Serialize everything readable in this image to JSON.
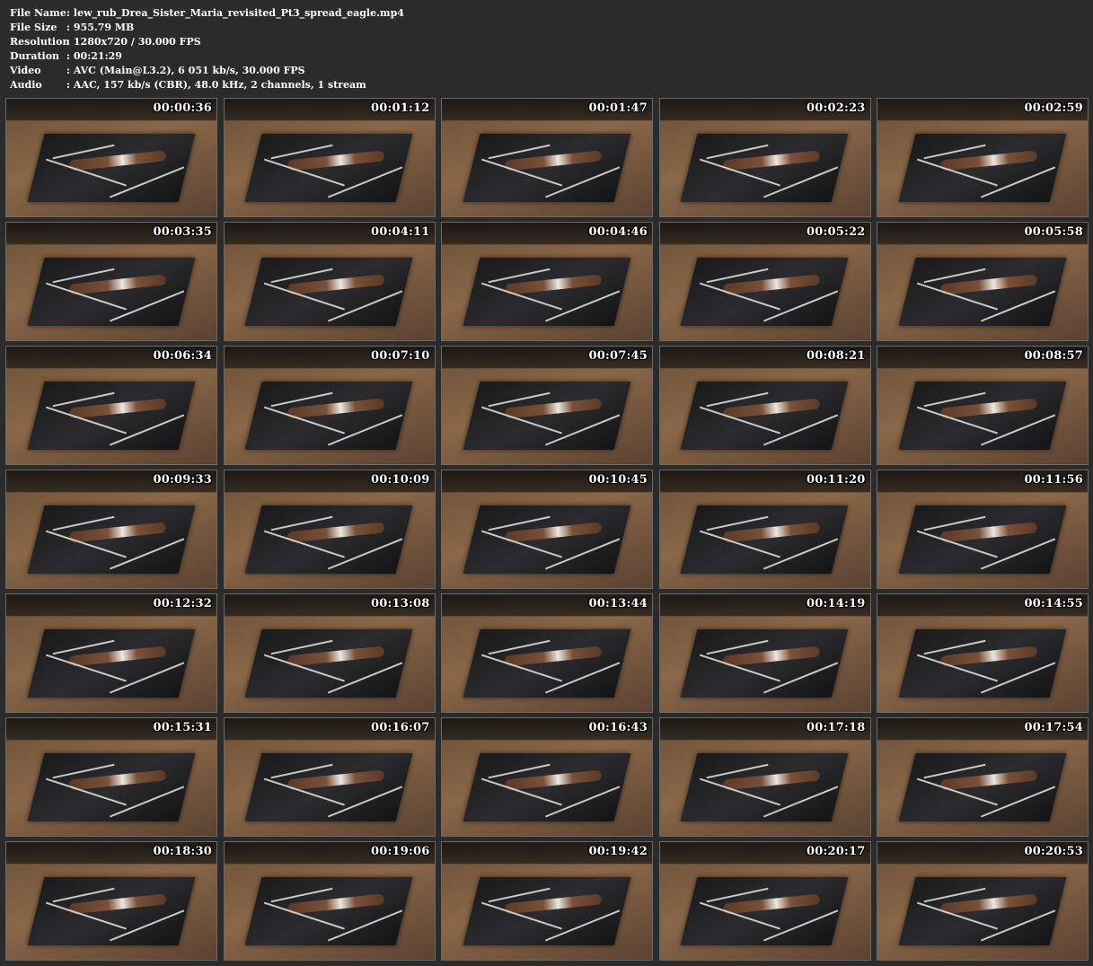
{
  "media_info": [
    {
      "label": "File Name",
      "value": "lew_rub_Drea_Sister_Maria_revisited_Pt3_spread_eagle.mp4"
    },
    {
      "label": "File Size",
      "value": "955.79 MB"
    },
    {
      "label": "Resolution",
      "value": "1280x720 / 30.000 FPS"
    },
    {
      "label": "Duration",
      "value": "00:21:29"
    },
    {
      "label": "Video",
      "value": "AVC (Main@L3.2), 6 051 kb/s, 30.000 FPS"
    },
    {
      "label": "Audio",
      "value": "AAC, 157 kb/s (CBR), 48.0 kHz, 2 channels, 1 stream"
    }
  ],
  "separator": ":",
  "thumbnails": [
    "00:00:36",
    "00:01:12",
    "00:01:47",
    "00:02:23",
    "00:02:59",
    "00:03:35",
    "00:04:11",
    "00:04:46",
    "00:05:22",
    "00:05:58",
    "00:06:34",
    "00:07:10",
    "00:07:45",
    "00:08:21",
    "00:08:57",
    "00:09:33",
    "00:10:09",
    "00:10:45",
    "00:11:20",
    "00:11:56",
    "00:12:32",
    "00:13:08",
    "00:13:44",
    "00:14:19",
    "00:14:55",
    "00:15:31",
    "00:16:07",
    "00:16:43",
    "00:17:18",
    "00:17:54",
    "00:18:30",
    "00:19:06",
    "00:19:42",
    "00:20:17",
    "00:20:53"
  ]
}
